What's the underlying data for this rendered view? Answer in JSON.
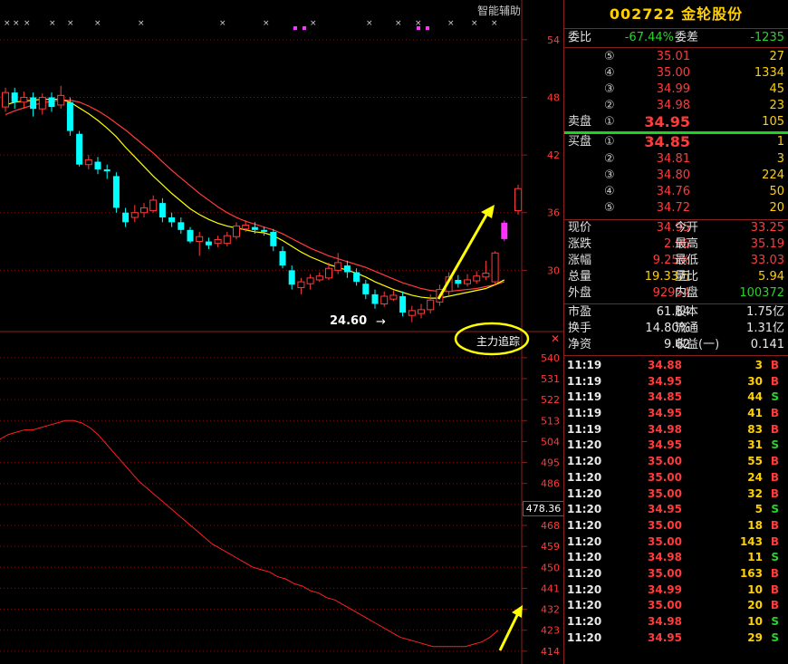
{
  "chart": {
    "helper_label": "智能辅助",
    "indicator_name": "主力追踪",
    "low_label": "24.60",
    "indicator_value_badge": "478.36",
    "close_icon": "close-icon",
    "price_axis": [
      "54",
      "48",
      "42",
      "36",
      "30"
    ],
    "indicator_axis": [
      "540",
      "531",
      "522",
      "513",
      "504",
      "495",
      "486",
      "477",
      "468",
      "459",
      "450",
      "441",
      "432",
      "423",
      "414"
    ],
    "colors": {
      "up": "#ff3b3b",
      "down": "#00ffff",
      "ma_fast": "#ffff00",
      "ma_slow": "#ff3b3b",
      "indicator": "#ff2020",
      "arrow": "#ffff00",
      "highlight": "#ff33ff"
    }
  },
  "chart_data": {
    "type": "candlestick",
    "ylim": [
      24,
      57
    ],
    "candles": [
      {
        "o": 47.0,
        "c": 48.5,
        "h": 49.0,
        "l": 46.5
      },
      {
        "o": 48.5,
        "c": 47.5,
        "h": 49.0,
        "l": 46.8
      },
      {
        "o": 47.5,
        "c": 48.0,
        "h": 48.6,
        "l": 46.8
      },
      {
        "o": 48.0,
        "c": 46.8,
        "h": 48.5,
        "l": 46.0
      },
      {
        "o": 46.8,
        "c": 48.0,
        "h": 48.4,
        "l": 46.2
      },
      {
        "o": 48.0,
        "c": 47.0,
        "h": 48.5,
        "l": 46.5
      },
      {
        "o": 47.2,
        "c": 48.2,
        "h": 49.2,
        "l": 46.8
      },
      {
        "o": 47.5,
        "c": 44.5,
        "h": 48.0,
        "l": 44.0
      },
      {
        "o": 44.2,
        "c": 41.0,
        "h": 44.5,
        "l": 40.8
      },
      {
        "o": 41.0,
        "c": 41.5,
        "h": 42.0,
        "l": 40.5
      },
      {
        "o": 41.3,
        "c": 40.5,
        "h": 41.8,
        "l": 40.0
      },
      {
        "o": 40.5,
        "c": 40.3,
        "h": 41.0,
        "l": 39.5
      },
      {
        "o": 39.8,
        "c": 36.5,
        "h": 40.2,
        "l": 36.0
      },
      {
        "o": 36.0,
        "c": 35.0,
        "h": 36.5,
        "l": 34.5
      },
      {
        "o": 35.5,
        "c": 36.0,
        "h": 36.8,
        "l": 35.0
      },
      {
        "o": 36.0,
        "c": 36.5,
        "h": 37.0,
        "l": 35.5
      },
      {
        "o": 36.2,
        "c": 37.3,
        "h": 37.8,
        "l": 36.0
      },
      {
        "o": 37.0,
        "c": 35.5,
        "h": 37.5,
        "l": 35.0
      },
      {
        "o": 35.5,
        "c": 35.0,
        "h": 36.0,
        "l": 34.5
      },
      {
        "o": 35.0,
        "c": 34.2,
        "h": 35.5,
        "l": 33.8
      },
      {
        "o": 34.2,
        "c": 33.0,
        "h": 34.5,
        "l": 32.8
      },
      {
        "o": 33.0,
        "c": 33.5,
        "h": 34.0,
        "l": 31.5
      },
      {
        "o": 33.0,
        "c": 32.6,
        "h": 33.4,
        "l": 32.2
      },
      {
        "o": 32.8,
        "c": 33.2,
        "h": 33.6,
        "l": 32.4
      },
      {
        "o": 32.8,
        "c": 33.6,
        "h": 34.0,
        "l": 32.5
      },
      {
        "o": 33.5,
        "c": 34.6,
        "h": 35.0,
        "l": 33.2
      },
      {
        "o": 34.3,
        "c": 34.7,
        "h": 35.2,
        "l": 34.0
      },
      {
        "o": 34.5,
        "c": 34.2,
        "h": 35.0,
        "l": 33.8
      },
      {
        "o": 34.2,
        "c": 34.0,
        "h": 34.5,
        "l": 33.6
      },
      {
        "o": 34.0,
        "c": 32.5,
        "h": 34.3,
        "l": 32.0
      },
      {
        "o": 32.0,
        "c": 30.5,
        "h": 32.5,
        "l": 30.2
      },
      {
        "o": 30.0,
        "c": 28.5,
        "h": 30.5,
        "l": 28.0
      },
      {
        "o": 28.2,
        "c": 28.8,
        "h": 29.2,
        "l": 27.5
      },
      {
        "o": 28.6,
        "c": 29.2,
        "h": 29.6,
        "l": 28.0
      },
      {
        "o": 29.0,
        "c": 29.4,
        "h": 29.8,
        "l": 28.8
      },
      {
        "o": 29.2,
        "c": 30.2,
        "h": 30.8,
        "l": 29.0
      },
      {
        "o": 30.0,
        "c": 30.8,
        "h": 31.8,
        "l": 29.6
      },
      {
        "o": 30.5,
        "c": 29.8,
        "h": 31.0,
        "l": 29.2
      },
      {
        "o": 29.8,
        "c": 28.8,
        "h": 30.2,
        "l": 28.4
      },
      {
        "o": 28.6,
        "c": 27.5,
        "h": 29.0,
        "l": 27.0
      },
      {
        "o": 27.5,
        "c": 26.5,
        "h": 28.0,
        "l": 26.0
      },
      {
        "o": 26.5,
        "c": 27.3,
        "h": 27.8,
        "l": 26.2
      },
      {
        "o": 27.0,
        "c": 27.4,
        "h": 27.9,
        "l": 26.8
      },
      {
        "o": 27.3,
        "c": 25.6,
        "h": 27.8,
        "l": 25.2
      },
      {
        "o": 25.3,
        "c": 25.8,
        "h": 26.3,
        "l": 24.6
      },
      {
        "o": 25.5,
        "c": 25.9,
        "h": 26.5,
        "l": 25.0
      },
      {
        "o": 25.9,
        "c": 26.9,
        "h": 27.5,
        "l": 25.5
      },
      {
        "o": 26.7,
        "c": 28.0,
        "h": 28.5,
        "l": 26.3
      },
      {
        "o": 27.8,
        "c": 29.3,
        "h": 29.8,
        "l": 27.4
      },
      {
        "o": 29.0,
        "c": 28.6,
        "h": 29.5,
        "l": 28.2
      },
      {
        "o": 28.6,
        "c": 29.0,
        "h": 29.6,
        "l": 28.3
      },
      {
        "o": 28.9,
        "c": 29.4,
        "h": 29.9,
        "l": 28.6
      },
      {
        "o": 29.3,
        "c": 29.7,
        "h": 31.0,
        "l": 29.0
      },
      {
        "o": 28.8,
        "c": 31.8,
        "h": 32.0,
        "l": 28.5
      },
      {
        "o": 33.25,
        "c": 34.95,
        "h": 35.19,
        "l": 33.03
      }
    ],
    "ma_fast": [
      47.2,
      47.5,
      47.6,
      47.7,
      47.8,
      47.8,
      47.8,
      47.5,
      46.9,
      46.3,
      45.6,
      44.8,
      43.9,
      42.8,
      41.8,
      40.8,
      39.8,
      38.9,
      38.0,
      37.2,
      36.4,
      35.8,
      35.3,
      34.9,
      34.6,
      34.4,
      34.2,
      34.0,
      33.9,
      33.6,
      33.1,
      32.5,
      31.9,
      31.4,
      31.0,
      30.6,
      30.3,
      30.0,
      29.7,
      29.3,
      28.8,
      28.4,
      28.0,
      27.7,
      27.4,
      27.2,
      27.1,
      27.1,
      27.3,
      27.5,
      27.7,
      27.9,
      28.1,
      28.5,
      29.0
    ],
    "ma_slow": [
      46.2,
      46.6,
      46.9,
      47.2,
      47.4,
      47.6,
      47.7,
      47.7,
      47.5,
      47.1,
      46.6,
      46.0,
      45.3,
      44.6,
      43.8,
      43.0,
      42.2,
      41.3,
      40.4,
      39.6,
      38.8,
      38.0,
      37.3,
      36.6,
      36.0,
      35.5,
      35.1,
      34.8,
      34.5,
      34.2,
      33.8,
      33.3,
      32.8,
      32.3,
      31.9,
      31.5,
      31.2,
      30.9,
      30.6,
      30.3,
      29.9,
      29.5,
      29.1,
      28.7,
      28.4,
      28.1,
      27.9,
      27.8,
      27.8,
      27.9,
      28.0,
      28.1,
      28.3,
      28.5,
      28.8
    ],
    "indicator": {
      "ylim": [
        412,
        545
      ],
      "values": [
        505,
        507,
        508,
        509,
        509,
        510,
        511,
        512,
        513,
        513,
        512,
        510,
        507,
        503,
        499,
        495,
        491,
        487,
        484,
        481,
        478,
        475,
        472,
        469,
        466,
        463,
        460,
        458,
        456,
        454,
        452,
        450,
        449,
        448,
        446,
        445,
        443,
        442,
        440,
        439,
        437,
        436,
        434,
        432,
        430,
        428,
        426,
        424,
        422,
        420,
        419,
        418,
        417,
        416,
        416,
        416,
        416,
        416,
        417,
        418,
        420,
        423
      ]
    }
  },
  "quote": {
    "code_name": "002722 金轮股份",
    "weibi_label": "委比",
    "weibi_value": "-67.44%",
    "weicha_label": "委差",
    "weicha_value": "-1235",
    "sell_label": "卖盘",
    "buy_label": "买盘",
    "sells": [
      {
        "level": "⑤",
        "price": "35.01",
        "vol": "27"
      },
      {
        "level": "④",
        "price": "35.00",
        "vol": "1334"
      },
      {
        "level": "③",
        "price": "34.99",
        "vol": "45"
      },
      {
        "level": "②",
        "price": "34.98",
        "vol": "23"
      },
      {
        "level": "①",
        "price": "34.95",
        "vol": "105"
      }
    ],
    "buys": [
      {
        "level": "①",
        "price": "34.85",
        "vol": "1"
      },
      {
        "level": "②",
        "price": "34.81",
        "vol": "3"
      },
      {
        "level": "③",
        "price": "34.80",
        "vol": "224"
      },
      {
        "level": "④",
        "price": "34.76",
        "vol": "50"
      },
      {
        "level": "⑤",
        "price": "34.72",
        "vol": "20"
      }
    ],
    "stats": [
      {
        "l1": "现价",
        "v1": "34.95",
        "c1": "red",
        "l2": "今开",
        "v2": "33.25",
        "c2": "red"
      },
      {
        "l1": "涨跌",
        "v1": "2.96",
        "c1": "red",
        "l2": "最高",
        "v2": "35.19",
        "c2": "red"
      },
      {
        "l1": "涨幅",
        "v1": "9.25%",
        "c1": "red",
        "l2": "最低",
        "v2": "33.03",
        "c2": "red"
      },
      {
        "l1": "总量",
        "v1": "19.33万",
        "c1": "yellow",
        "l2": "量比",
        "v2": "5.94",
        "c2": "yellow"
      },
      {
        "l1": "外盘",
        "v1": "92954",
        "c1": "red",
        "l2": "内盘",
        "v2": "100372",
        "c2": "green"
      }
    ],
    "stats2": [
      {
        "l1": "市盈",
        "v1": "61.84",
        "l2": "股本",
        "v2": "1.75亿"
      },
      {
        "l1": "换手",
        "v1": "14.80%",
        "l2": "流通",
        "v2": "1.31亿"
      },
      {
        "l1": "净资",
        "v1": "9.62",
        "l2": "收益(一)",
        "v2": "0.141"
      }
    ],
    "ticks": [
      {
        "t": "11:19",
        "p": "34.88",
        "v": "3",
        "d": "B"
      },
      {
        "t": "11:19",
        "p": "34.95",
        "v": "30",
        "d": "B"
      },
      {
        "t": "11:19",
        "p": "34.85",
        "v": "44",
        "d": "S"
      },
      {
        "t": "11:19",
        "p": "34.95",
        "v": "41",
        "d": "B"
      },
      {
        "t": "11:19",
        "p": "34.98",
        "v": "83",
        "d": "B"
      },
      {
        "t": "11:20",
        "p": "34.95",
        "v": "31",
        "d": "S"
      },
      {
        "t": "11:20",
        "p": "35.00",
        "v": "55",
        "d": "B"
      },
      {
        "t": "11:20",
        "p": "35.00",
        "v": "24",
        "d": "B"
      },
      {
        "t": "11:20",
        "p": "35.00",
        "v": "32",
        "d": "B"
      },
      {
        "t": "11:20",
        "p": "34.95",
        "v": "5",
        "d": "S"
      },
      {
        "t": "11:20",
        "p": "35.00",
        "v": "18",
        "d": "B"
      },
      {
        "t": "11:20",
        "p": "35.00",
        "v": "143",
        "d": "B"
      },
      {
        "t": "11:20",
        "p": "34.98",
        "v": "11",
        "d": "S"
      },
      {
        "t": "11:20",
        "p": "35.00",
        "v": "163",
        "d": "B"
      },
      {
        "t": "11:20",
        "p": "34.99",
        "v": "10",
        "d": "B"
      },
      {
        "t": "11:20",
        "p": "35.00",
        "v": "20",
        "d": "B"
      },
      {
        "t": "11:20",
        "p": "34.98",
        "v": "10",
        "d": "S"
      },
      {
        "t": "11:20",
        "p": "34.95",
        "v": "29",
        "d": "S"
      }
    ]
  }
}
